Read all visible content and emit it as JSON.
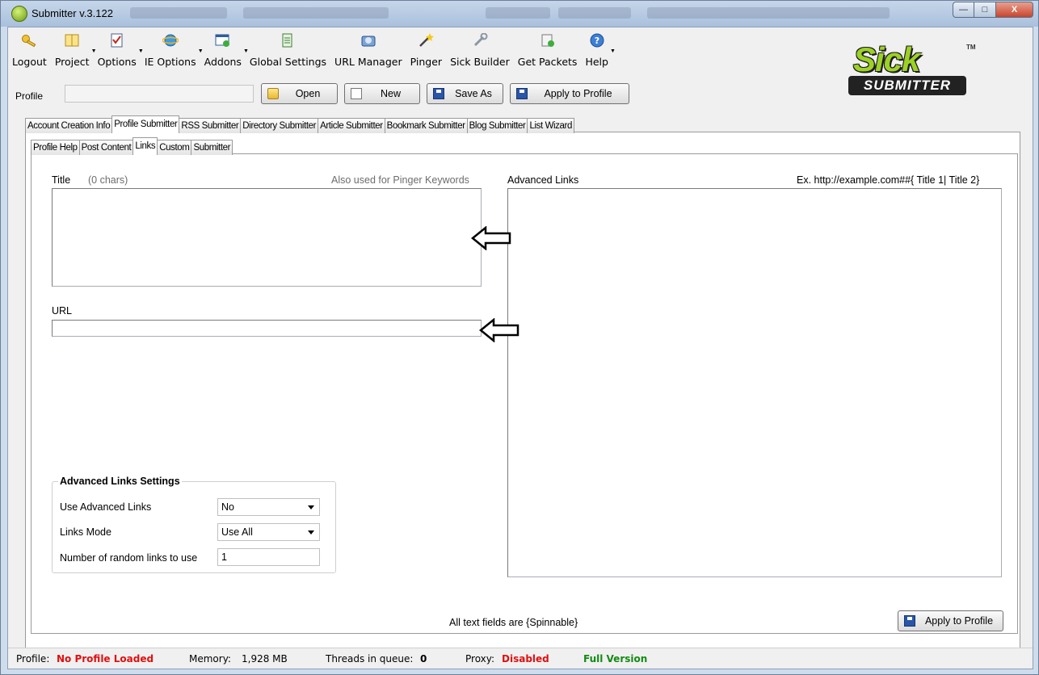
{
  "window": {
    "title": "Submitter v.3.122",
    "controls": {
      "minimize": "—",
      "maximize": "□",
      "close": "X"
    }
  },
  "toolbar": {
    "items": [
      {
        "label": "Logout",
        "icon": "key-icon",
        "dropdown": false
      },
      {
        "label": "Project",
        "icon": "book-icon",
        "dropdown": true
      },
      {
        "label": "Options",
        "icon": "checklist-icon",
        "dropdown": true
      },
      {
        "label": "IE Options",
        "icon": "ie-icon",
        "dropdown": true
      },
      {
        "label": "Addons",
        "icon": "window-add-icon",
        "dropdown": true
      },
      {
        "label": "Global Settings",
        "icon": "settings-doc-icon",
        "dropdown": false
      },
      {
        "label": "URL Manager",
        "icon": "url-manager-icon",
        "dropdown": false
      },
      {
        "label": "Pinger",
        "icon": "wand-icon",
        "dropdown": false
      },
      {
        "label": "Sick Builder",
        "icon": "wrench-icon",
        "dropdown": false
      },
      {
        "label": "Get Packets",
        "icon": "packets-icon",
        "dropdown": false
      },
      {
        "label": "Help",
        "icon": "help-icon",
        "dropdown": true
      }
    ]
  },
  "logo": {
    "top": "Sick",
    "bottom": "SUBMITTER",
    "tm": "TM"
  },
  "profile": {
    "label": "Profile",
    "value": "",
    "buttons": {
      "open": "Open",
      "new": "New",
      "save_as": "Save As",
      "apply": "Apply to Profile"
    }
  },
  "main_tabs": [
    {
      "label": "Account Creation Info",
      "active": false
    },
    {
      "label": "Profile Submitter",
      "active": true
    },
    {
      "label": "RSS Submitter",
      "active": false
    },
    {
      "label": "Directory Submitter",
      "active": false
    },
    {
      "label": "Article Submitter",
      "active": false
    },
    {
      "label": "Bookmark Submitter",
      "active": false
    },
    {
      "label": "Blog Submitter",
      "active": false
    },
    {
      "label": "List Wizard",
      "active": false
    }
  ],
  "sub_tabs": [
    {
      "label": "Profile Help",
      "active": false
    },
    {
      "label": "Post Content",
      "active": false
    },
    {
      "label": "Links",
      "active": true
    },
    {
      "label": "Custom",
      "active": false
    },
    {
      "label": "Submitter",
      "active": false
    }
  ],
  "links": {
    "title_label": "Title",
    "title_count": "(0 chars)",
    "title_hint": "Also used for Pinger Keywords",
    "title_value": "",
    "url_label": "URL",
    "url_value": "",
    "advanced_label": "Advanced Links",
    "advanced_example": "Ex. http://example.com##{ Title 1| Title 2}",
    "advanced_value": ""
  },
  "settings": {
    "title": "Advanced Links Settings",
    "use_advanced_label": "Use Advanced Links",
    "use_advanced_value": "No",
    "links_mode_label": "Links Mode",
    "links_mode_value": "Use All",
    "random_label": "Number of random links to use",
    "random_value": "1"
  },
  "footer": {
    "note": "All text fields are {Spinnable}",
    "apply": "Apply to Profile"
  },
  "status": {
    "profile_label": "Profile:",
    "profile_value": "No Profile Loaded",
    "memory_label": "Memory:",
    "memory_value": "1,928 MB",
    "threads_label": "Threads in queue:",
    "threads_value": "0",
    "proxy_label": "Proxy:",
    "proxy_value": "Disabled",
    "version": "Full Version"
  },
  "colors": {
    "accent_green": "#9cd126",
    "status_red": "#e01010",
    "status_green": "#138a13"
  }
}
